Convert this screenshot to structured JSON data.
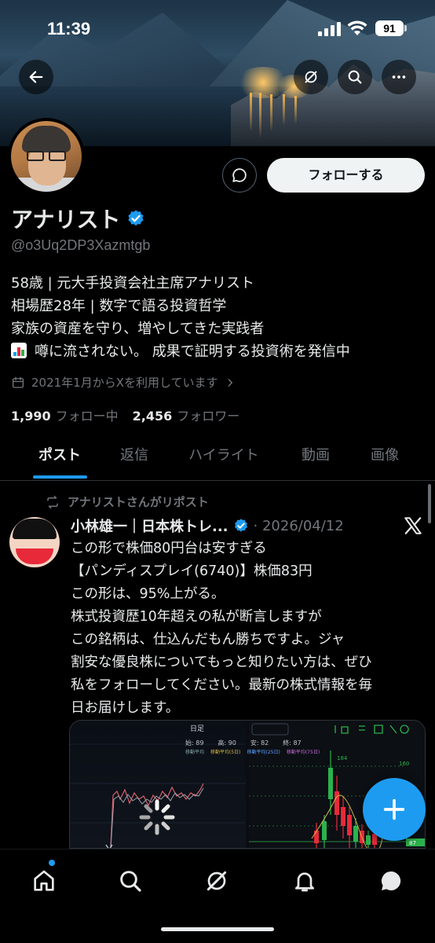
{
  "status_bar": {
    "time": "11:39",
    "battery": "91"
  },
  "profile": {
    "name": "アナリスト",
    "handle": "@o3Uq2DP3Xazmtgb",
    "follow_label": "フォローする",
    "bio": [
      "58歳 | 元大手投資会社主席アナリスト",
      "相場歴28年 | 数字で語る投資哲学",
      "家族の資産を守り、増やしてきた実践者",
      "噂に流されない。 成果で証明する投資術を発信中"
    ],
    "joined": "2021年1月からXを利用しています",
    "following_count": "1,990",
    "following_label": "フォロー中",
    "followers_count": "2,456",
    "followers_label": "フォロワー"
  },
  "tabs": [
    {
      "label": "ポスト"
    },
    {
      "label": "返信"
    },
    {
      "label": "ハイライト"
    },
    {
      "label": "動画"
    },
    {
      "label": "画像"
    }
  ],
  "post": {
    "repost_label": "アナリストさんがリポスト",
    "author": "小林雄一｜日本株トレ...",
    "date": "· 2026/04/12",
    "text": "この形で株価80円台は安すぎる\n【パンディスプレイ(6740)】株価83円\nこの形は、95%上がる。\n株式投資歴10年超えの私が断言しますが\nこの銘柄は、仕込んだもん勝ちですよ。ジャ\n割安な優良株についてもっと知りたい方は、ぜひ\n私をフォローしてください。最新の株式情報を毎\n日お届けします。",
    "chart": {
      "period": "日足",
      "open": "始: 89",
      "high": "高: 90",
      "low": "安: 82",
      "close": "終: 87",
      "ma": [
        "移動平均",
        "移動平均(5日)",
        "移動平均(25日)",
        "移動平均(75日)"
      ],
      "price_high": "184",
      "price_mid": "160",
      "price_last": "87"
    }
  },
  "colors": {
    "accent": "#1d9bf0",
    "background": "#000000",
    "text": "#e7e9ea",
    "muted": "#71767b"
  },
  "icons": {
    "back": "arrow-left-icon",
    "grok": "grok-icon",
    "search": "search-icon",
    "more": "more-icon",
    "message": "message-icon",
    "verified": "verified-badge-icon",
    "calendar": "calendar-icon",
    "repost": "repost-icon",
    "compose": "plus-icon",
    "home": "home-icon",
    "notifications": "bell-icon",
    "messages": "chat-icon"
  }
}
